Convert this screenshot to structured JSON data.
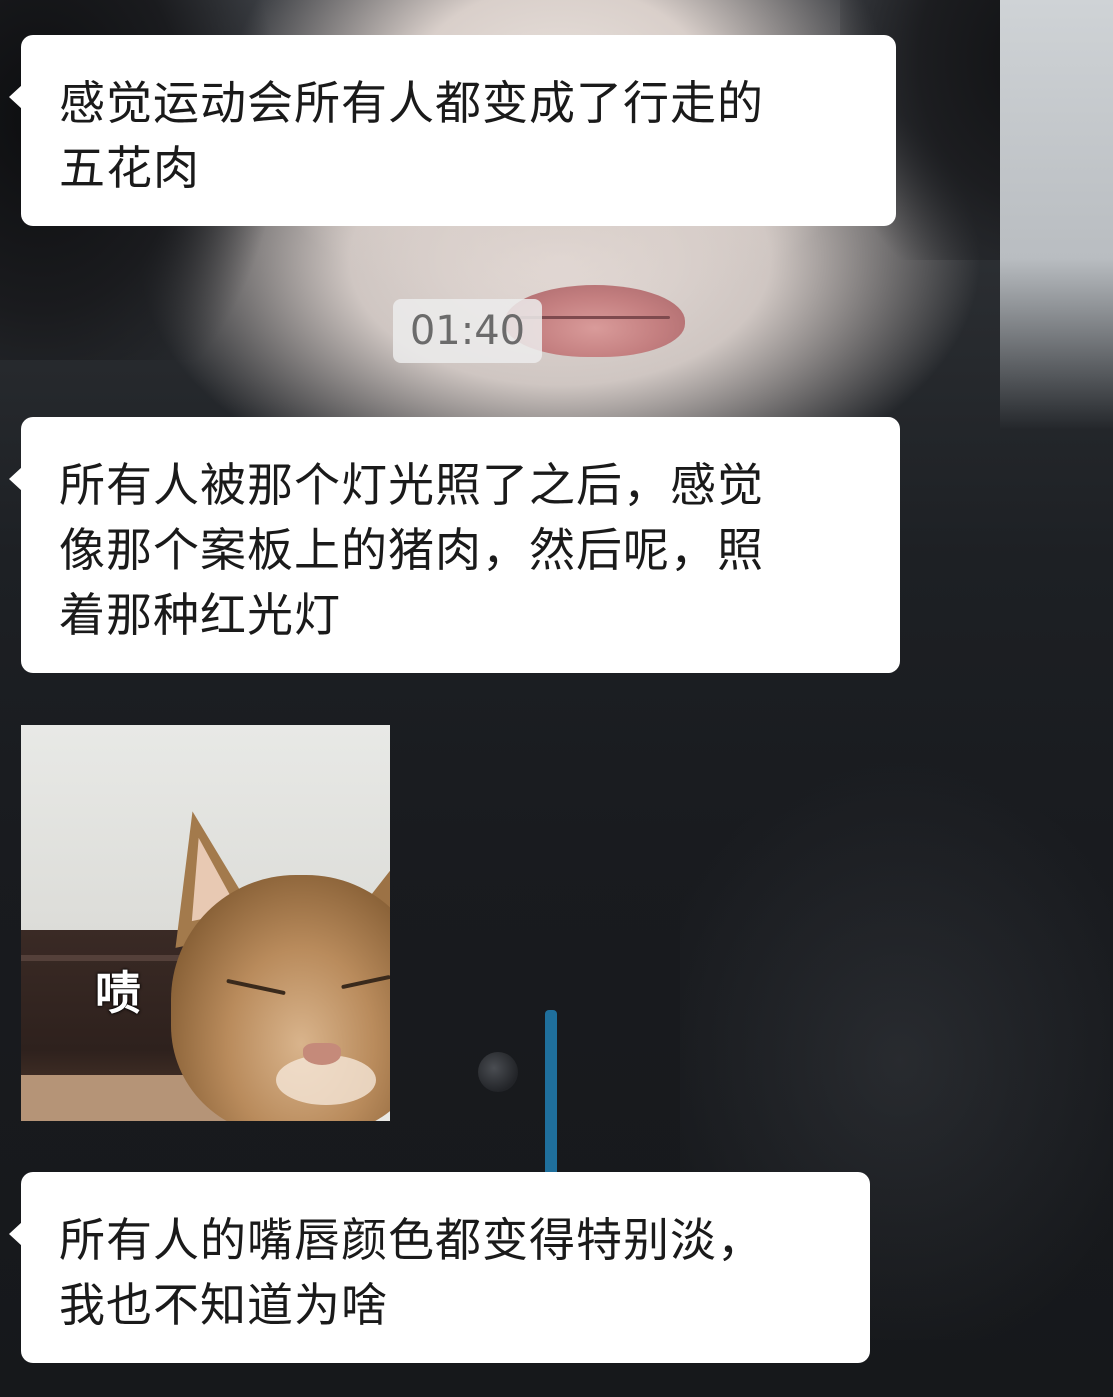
{
  "messages": [
    {
      "text": "感觉运动会所有人都变成了行走的\n五花肉"
    },
    {
      "text": "所有人被那个灯光照了之后，感觉\n像那个案板上的猪肉，然后呢，照\n着那种红光灯"
    },
    {
      "text": "所有人的嘴唇颜色都变得特别淡，\n我也不知道为啥"
    }
  ],
  "timestamp": "01:40",
  "sticker": {
    "caption": "啧",
    "subject": "cat-squinting"
  },
  "colors": {
    "bubble": "#ffffff",
    "text": "#1a1a1a",
    "time_pill": "#ececec",
    "time_text": "#6b6b6b"
  }
}
